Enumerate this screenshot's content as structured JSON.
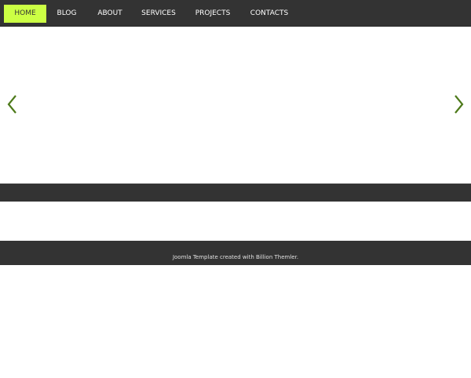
{
  "nav": {
    "items": [
      {
        "label": "HOME",
        "active": true
      },
      {
        "label": "BLOG",
        "active": false
      },
      {
        "label": "ABOUT",
        "active": false
      },
      {
        "label": "SERVICES",
        "active": false
      },
      {
        "label": "PROJECTS",
        "active": false
      },
      {
        "label": "CONTACTS",
        "active": false
      }
    ]
  },
  "slider": {
    "prev_icon": "chevron-left-icon",
    "next_icon": "chevron-right-icon",
    "arrow_color": "#4d7a1a"
  },
  "footer": {
    "text": "Joomla Template created with Billion Themler."
  },
  "colors": {
    "bar": "#333333",
    "accent": "#ccff44"
  }
}
